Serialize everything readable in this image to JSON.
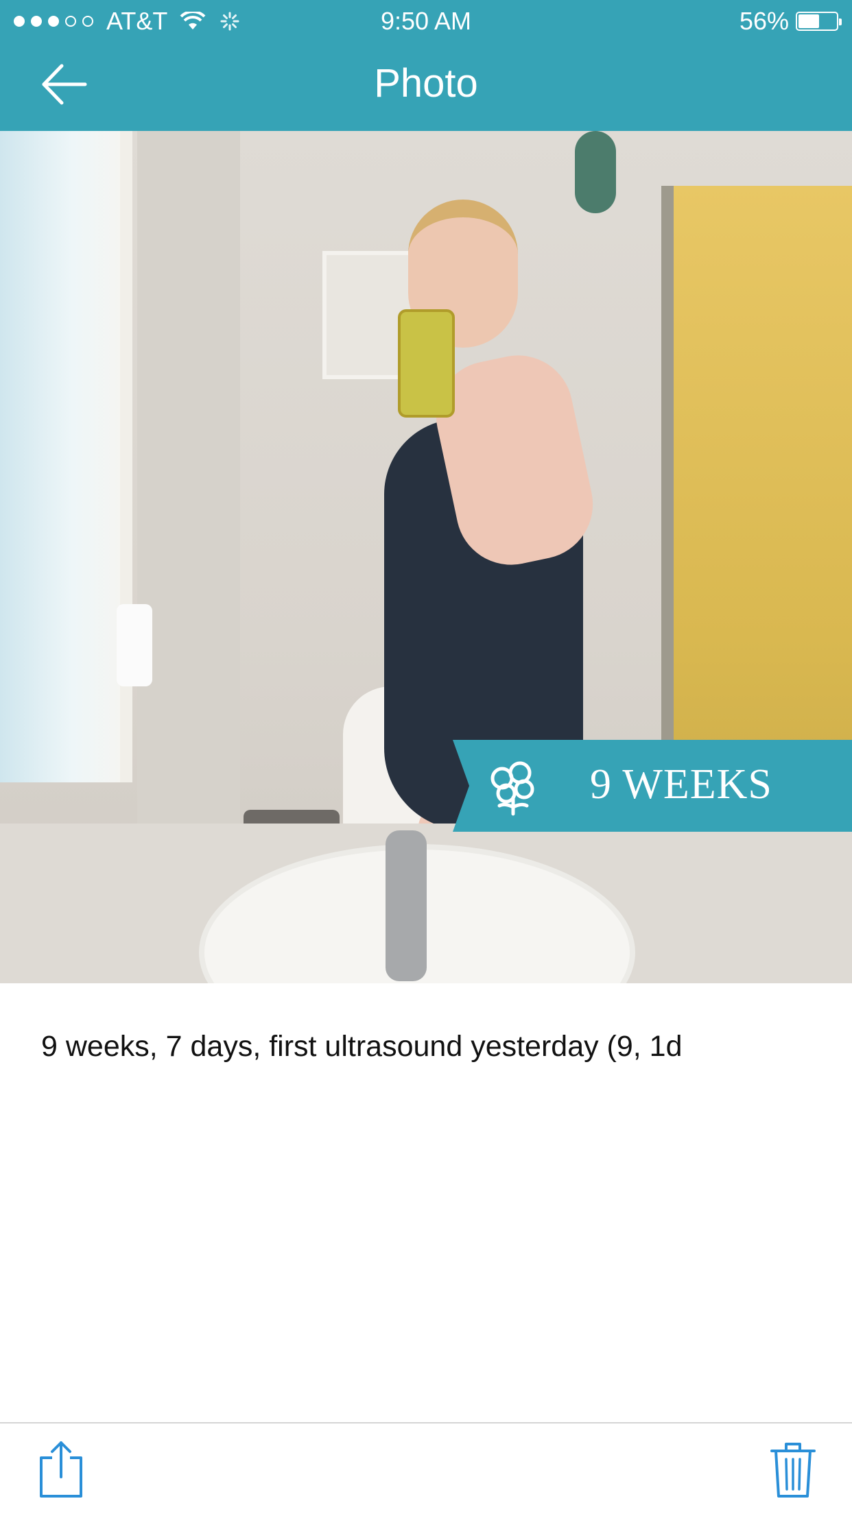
{
  "status_bar": {
    "carrier": "AT&T",
    "time": "9:50 AM",
    "battery_text": "56%",
    "battery_level": 0.56
  },
  "nav": {
    "title": "Photo",
    "back_icon": "arrow-left-icon"
  },
  "photo": {
    "badge_text": "9 WEEKS",
    "badge_icon": "cotton-flower-icon"
  },
  "caption": "9 weeks, 7 days, first ultrasound yesterday (9, 1d",
  "toolbar": {
    "share_icon": "share-icon",
    "trash_icon": "trash-icon"
  },
  "colors": {
    "accent": "#36a3b6",
    "toolbar_icons": "#2a8fd8"
  }
}
